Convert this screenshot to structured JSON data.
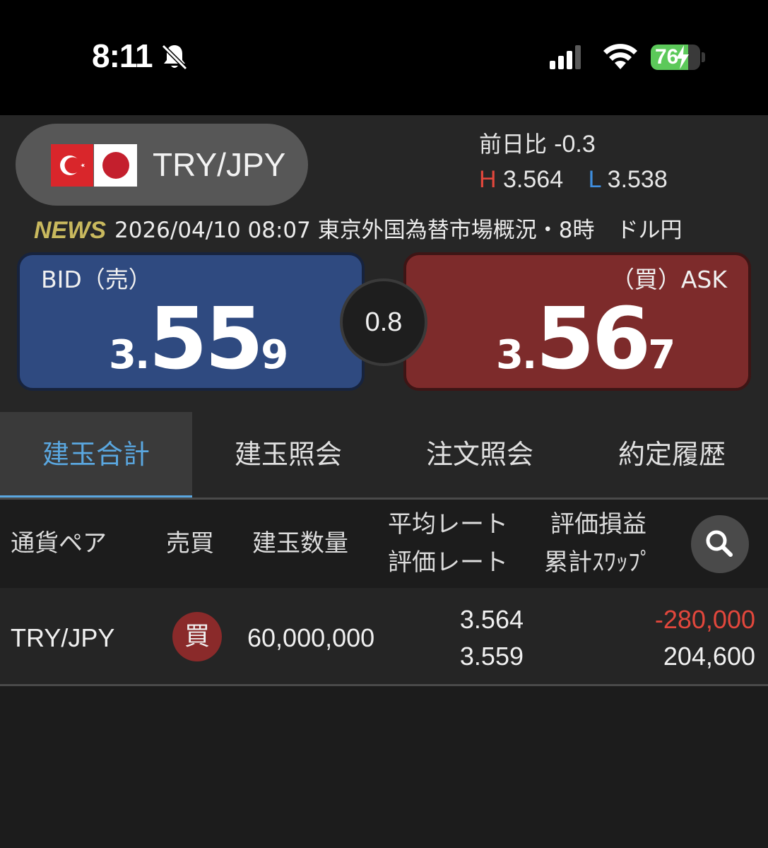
{
  "status_bar": {
    "time": "8:11",
    "battery_percent": "76",
    "battery_level": 0.76,
    "icons": [
      "bell-slash-icon",
      "cellular-signal-icon",
      "wifi-icon",
      "battery-charging-icon"
    ]
  },
  "header": {
    "pair": "TRY/JPY",
    "flags": [
      "turkey-flag-icon",
      "japan-flag-icon"
    ],
    "change_label": "前日比",
    "change_value": "-0.3",
    "high_label": "H",
    "high_value": "3.564",
    "low_label": "L",
    "low_value": "3.538"
  },
  "news": {
    "tag": "NEWS",
    "text": "2026/04/10 08:07 東京外国為替市場概況・8時　ドル円"
  },
  "quote": {
    "bid_label": "BID（売）",
    "bid_prefix": "3.",
    "bid_big": "55",
    "bid_last": "9",
    "ask_label": "（買）ASK",
    "ask_prefix": "3.",
    "ask_big": "56",
    "ask_last": "7",
    "spread": "0.8"
  },
  "tabs": [
    {
      "label": "建玉合計",
      "active": true
    },
    {
      "label": "建玉照会",
      "active": false
    },
    {
      "label": "注文照会",
      "active": false
    },
    {
      "label": "約定履歴",
      "active": false
    }
  ],
  "table": {
    "headers": {
      "pair": "通貨ペア",
      "side": "売買",
      "quantity": "建玉数量",
      "avg_rate": "平均レート",
      "eval_rate": "評価レート",
      "pnl": "評価損益",
      "swap": "累計ｽﾜｯﾌﾟ"
    },
    "rows": [
      {
        "pair": "TRY/JPY",
        "side": "買",
        "quantity": "60,000,000",
        "avg_rate": "3.564",
        "eval_rate": "3.559",
        "pnl": "-280,000",
        "swap": "204,600"
      }
    ]
  },
  "colors": {
    "bid": "#2f4a80",
    "ask": "#7d2b2b",
    "accent": "#5aa7e0",
    "negative": "#e2473c",
    "news_tag": "#c9b95e"
  }
}
